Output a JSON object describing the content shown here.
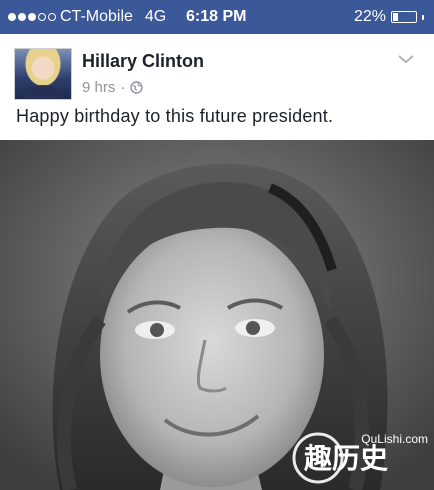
{
  "status_bar": {
    "carrier": "CT-Mobile",
    "network": "4G",
    "time": "6:18 PM",
    "battery_text": "22%",
    "battery_level": 0.22,
    "signal_filled": 3,
    "signal_total": 5
  },
  "post": {
    "author": "Hillary Clinton",
    "timestamp": "9 hrs",
    "separator": "·",
    "privacy_icon": "globe-icon",
    "text": "Happy birthday to this future president."
  },
  "watermark": {
    "site": "QuLishi.com",
    "logo_text": "趣历史"
  },
  "colors": {
    "status_bar_bg": "#3b5998",
    "name_text": "#1d2129",
    "meta_text": "#90949c"
  }
}
